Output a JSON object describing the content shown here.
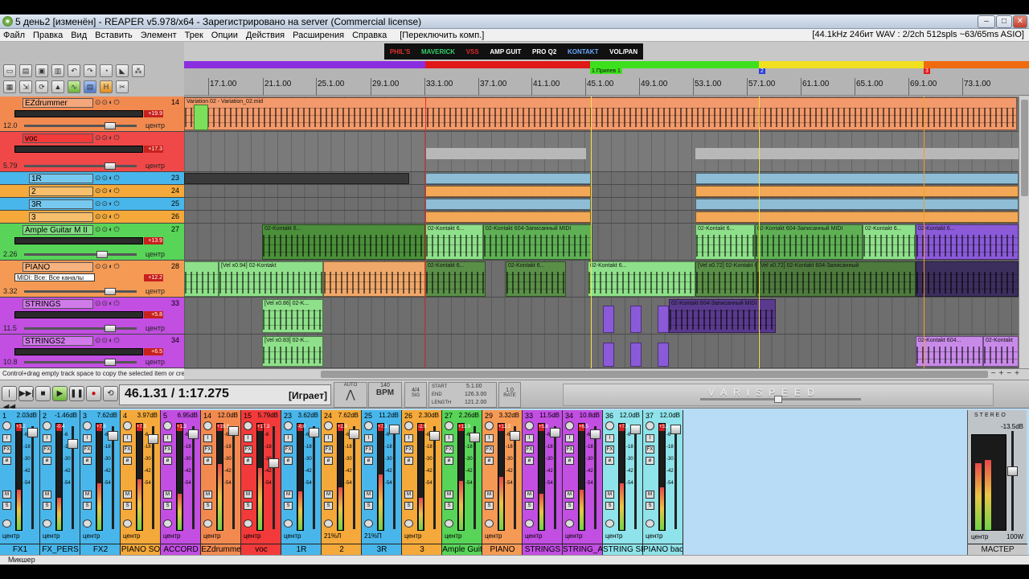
{
  "window": {
    "title": "5 день2 [изменён] - REAPER v5.978/x64 - Зарегистрировано на server (Commercial license)",
    "min_label": "–",
    "max_label": "□",
    "close_label": "✕"
  },
  "menu": {
    "items": [
      "Файл",
      "Правка",
      "Вид",
      "Вставить",
      "Элемент",
      "Трек",
      "Опции",
      "Действия",
      "Расширения",
      "Справка",
      "[Переключить комп.]"
    ],
    "status": "[44.1kHz 24бит WAV : 2/2ch 512spls ~63/65ms ASIO]"
  },
  "fx_toolbar": {
    "items": [
      {
        "label": "PHIL'S",
        "color": "#e03030"
      },
      {
        "label": "MAVERICK",
        "color": "#32d16a"
      },
      {
        "label": "VSS",
        "color": "#e02a2a"
      },
      {
        "label": "AMP GUIT",
        "color": "#ffffff"
      },
      {
        "label": "PRO Q2",
        "color": "#ffffff"
      },
      {
        "label": "KONTAKT",
        "color": "#6aa8ff"
      },
      {
        "label": "VOL/PAN",
        "color": "#ffffff"
      }
    ]
  },
  "ruler": {
    "ticks": [
      "17.1.00",
      "21.1.00",
      "25.1.00",
      "29.1.00",
      "33.1.00",
      "37.1.00",
      "41.1.00",
      "45.1.00",
      "49.1.00",
      "53.1.00",
      "57.1.00",
      "61.1.00",
      "65.1.00",
      "69.1.00",
      "73.1.00"
    ],
    "markers": [
      "1 Припев 1",
      "2",
      "3"
    ]
  },
  "tracks": [
    {
      "name": "EZdrummer",
      "num": "14",
      "vol": "12.0",
      "pan": "центр",
      "vu": "+19.9",
      "color": "#f28a50"
    },
    {
      "name": "voc",
      "num": "",
      "vol": "5.79",
      "pan": "центр",
      "vu": "+17.3",
      "color": "#f23a3a"
    },
    {
      "name": "1R",
      "num": "23",
      "vol": "",
      "pan": "",
      "vu": "",
      "color": "#48b6ea"
    },
    {
      "name": "2",
      "num": "24",
      "vol": "",
      "pan": "",
      "vu": "",
      "color": "#f4a93a"
    },
    {
      "name": "3R",
      "num": "25",
      "vol": "",
      "pan": "",
      "vu": "",
      "color": "#48b6ea"
    },
    {
      "name": "3",
      "num": "26",
      "vol": "",
      "pan": "",
      "vu": "",
      "color": "#f4a93a"
    },
    {
      "name": "Ample Guitar M II",
      "num": "27",
      "vol": "2.26",
      "pan": "центр",
      "vu": "+13.9",
      "color": "#58d458"
    },
    {
      "name": "PIANO",
      "num": "28",
      "vol": "3.32",
      "pan": "центр",
      "vu": "+12.2",
      "color": "#f59a55",
      "mode": "MIDI: Все: Все каналы"
    },
    {
      "name": "STRINGS",
      "num": "33",
      "vol": "11.5",
      "pan": "центр",
      "vu": "+5.8",
      "color": "#c24ee2"
    },
    {
      "name": "STRINGS2",
      "num": "34",
      "vol": "10.8",
      "pan": "центр",
      "vu": "+6.5",
      "color": "#c24ee2"
    }
  ],
  "clips": {
    "variation": "Variation 02 - Variation_02.mid",
    "kontakt": "02-Kontakt 604-Записанный MIDI",
    "kontakt_short": "02-Kontakt 6...",
    "vel94": "[Vel x0.94] 02-Kontakt",
    "vel72": "[Vel x0.72] 02-Kontakt 604-Записанный",
    "vel86": "[Vel x0.86] 02-K...",
    "vel83": "[Vel x0.83] 02-K...",
    "kontakt_sh2": "02-Kontakt 604...",
    "kontakt_sh3": "02-Kontakt"
  },
  "status_hint": "Control+drag empty track space to copy the selected item or create a new...",
  "transport": {
    "time": "46.1.31 / 1:17.275",
    "state": "[Играет]",
    "auto_label": "AUTO",
    "bpm": "140",
    "bpm_label": "BPM",
    "sig": "4/4",
    "sig_label": "SIG",
    "start_label": "START",
    "start": "5.1.00",
    "end_label": "END",
    "end": "126.3.00",
    "length_label": "LENGTH",
    "length": "121.2.00",
    "rate_label": "RATE",
    "rate": "1.0",
    "varispeed": "VARISPEED",
    "btn_rewind": "|◀◀",
    "btn_forward": "▶▶|",
    "btn_stop": "■",
    "btn_play": "▶",
    "btn_pause": "❚❚",
    "btn_record": "●",
    "btn_repeat": "⟲"
  },
  "mixer": {
    "scale": [
      "-6",
      "-18",
      "-30",
      "-42",
      "-54"
    ],
    "strips": [
      {
        "num": "1",
        "db": "2.03dB",
        "peak": "+3.2",
        "pan": "центр",
        "label": "FX1",
        "color": "#48b6ea"
      },
      {
        "num": "2",
        "db": "-1.46dB",
        "peak": "-0.4",
        "pan": "центр",
        "label": "FX_PERS",
        "color": "#48b6ea"
      },
      {
        "num": "3",
        "db": "7.62dB",
        "peak": "+7.6",
        "pan": "центр",
        "label": "FX2",
        "color": "#48b6ea"
      },
      {
        "num": "4",
        "db": "3.97dB",
        "peak": "+7.3",
        "pan": "центр",
        "label": "PIANO SO",
        "color": "#f4a93a"
      },
      {
        "num": "5",
        "db": "6.95dB",
        "peak": "+1.3",
        "pan": "центр",
        "label": "ACCORD",
        "color": "#c24ee2"
      },
      {
        "num": "14",
        "db": "12.0dB",
        "peak": "+19.9",
        "pan": "центр",
        "label": "EZdrumme",
        "color": "#f28a50"
      },
      {
        "num": "15",
        "db": "5.79dB",
        "peak": "+17.3",
        "pan": "центр",
        "label": "voc",
        "color": "#f23a3a"
      },
      {
        "num": "23",
        "db": "3.62dB",
        "peak": "-6.0",
        "pan": "центр",
        "label": "1R",
        "color": "#48b6ea"
      },
      {
        "num": "24",
        "db": "7.62dB",
        "peak": "+2.9",
        "pan": "21%Л",
        "label": "2",
        "color": "#f4a93a"
      },
      {
        "num": "25",
        "db": "11.2dB",
        "peak": "+7.1",
        "pan": "21%П",
        "label": "3R",
        "color": "#48b6ea"
      },
      {
        "num": "26",
        "db": "2.30dB",
        "peak": "-2.9",
        "pan": "центр",
        "label": "3",
        "color": "#f4a93a"
      },
      {
        "num": "27",
        "db": "2.26dB",
        "peak": "+13.9",
        "pan": "центр",
        "label": "Ample Guit",
        "color": "#58d458"
      },
      {
        "num": "29",
        "db": "3.32dB",
        "peak": "+12.2",
        "pan": "центр",
        "label": "PIANO",
        "color": "#f59a55"
      },
      {
        "num": "33",
        "db": "11.5dB",
        "peak": "+5.8",
        "pan": "центр",
        "label": "STRINGS",
        "color": "#c24ee2"
      },
      {
        "num": "34",
        "db": "10.8dB",
        "peak": "+6.5",
        "pan": "центр",
        "label": "STRING_A",
        "color": "#c24ee2"
      },
      {
        "num": "36",
        "db": "12.0dB",
        "peak": "+7.9",
        "pan": "центр",
        "label": "STRING SI",
        "color": "#8fe3ea"
      },
      {
        "num": "37",
        "db": "12.0dB",
        "peak": "+3.1",
        "pan": "центр",
        "label": "PIANO bac",
        "color": "#8fe3ea"
      }
    ],
    "master": {
      "label": "МАСТЕР",
      "db": "-13.5dB",
      "pan": "центр",
      "width": "100W",
      "stereo": "STEREO"
    },
    "tab": "Микшер"
  }
}
